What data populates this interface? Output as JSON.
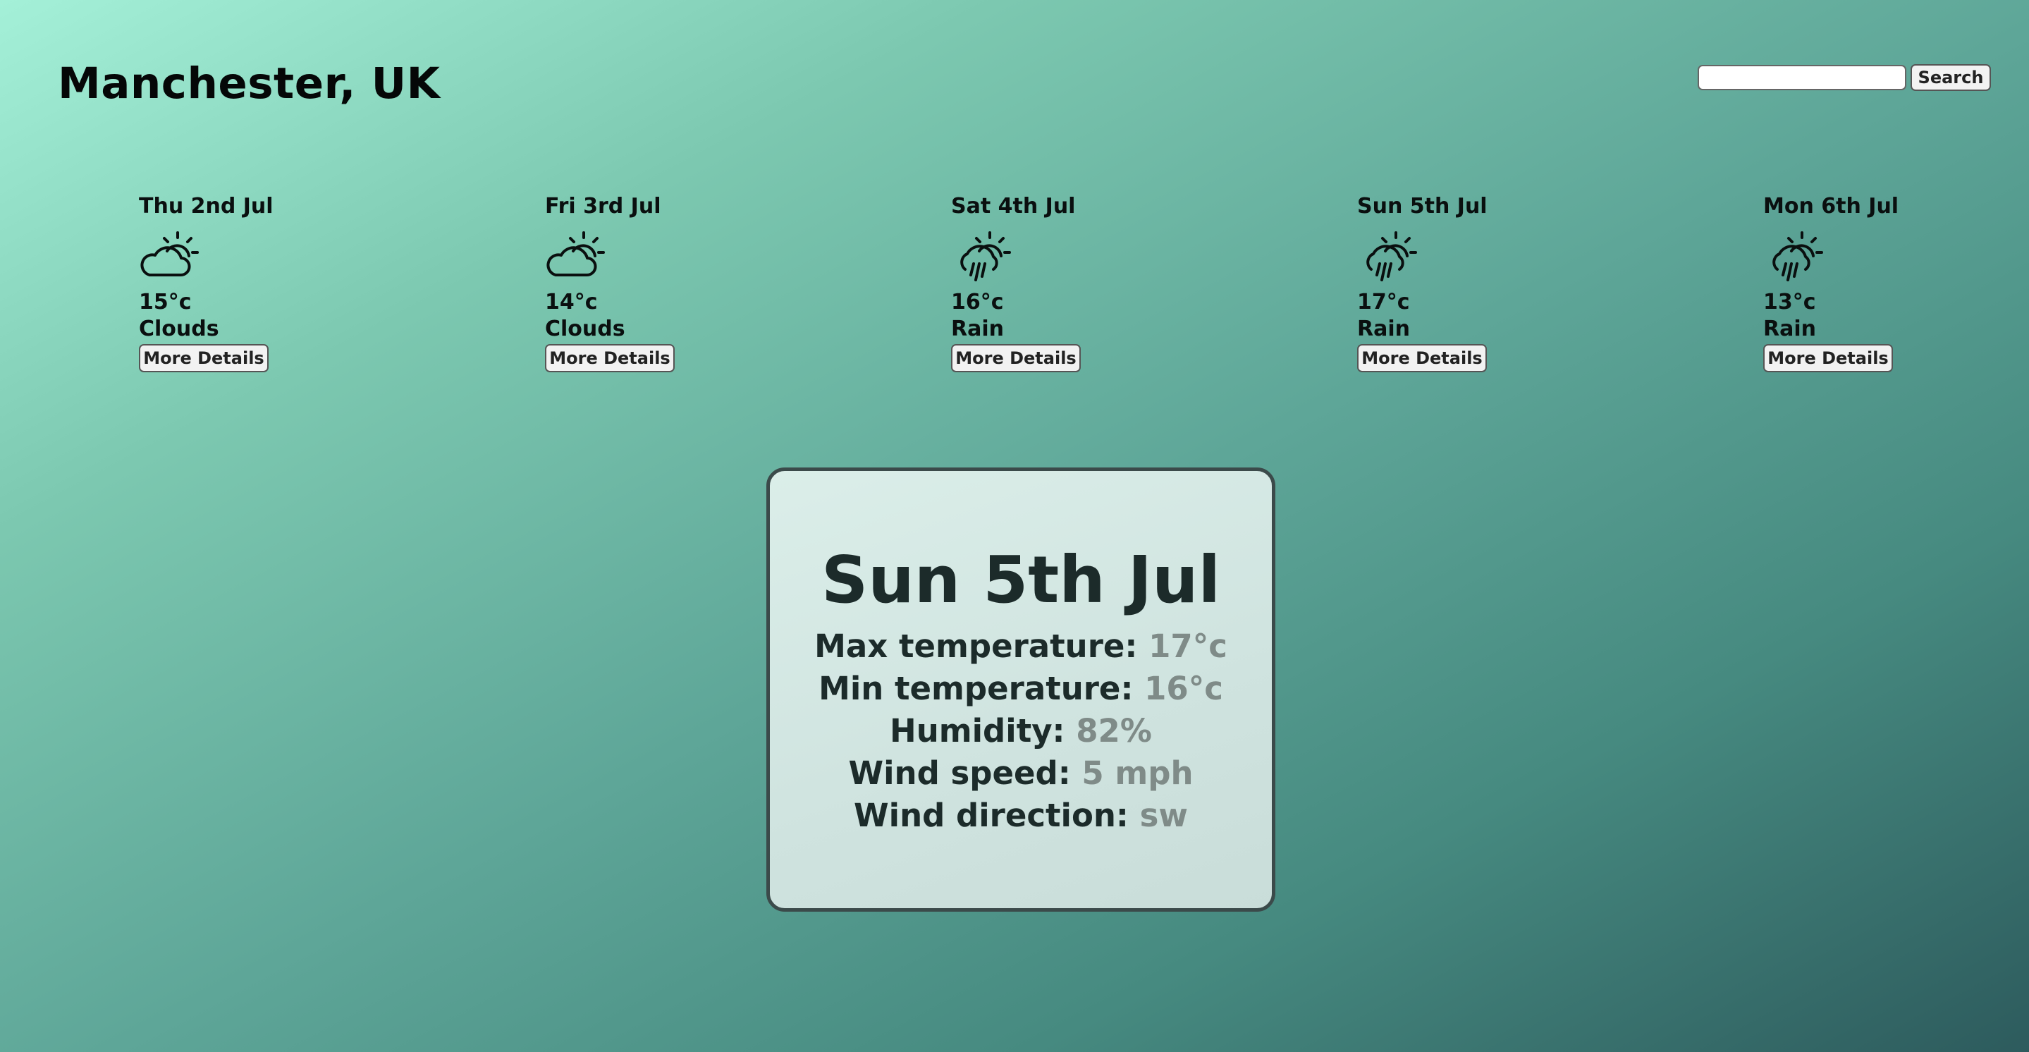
{
  "header": {
    "city": "Manchester, UK"
  },
  "search": {
    "value": "",
    "placeholder": "",
    "button_label": "Search"
  },
  "forecast": [
    {
      "date": "Thu 2nd Jul",
      "temp": "15°c",
      "description": "Clouds",
      "icon": "partly-cloudy-icon",
      "button_label": "More Details"
    },
    {
      "date": "Fri 3rd Jul",
      "temp": "14°c",
      "description": "Clouds",
      "icon": "partly-cloudy-icon",
      "button_label": "More Details"
    },
    {
      "date": "Sat 4th Jul",
      "temp": "16°c",
      "description": "Rain",
      "icon": "sun-rain-icon",
      "button_label": "More Details"
    },
    {
      "date": "Sun 5th Jul",
      "temp": "17°c",
      "description": "Rain",
      "icon": "sun-rain-icon",
      "button_label": "More Details"
    },
    {
      "date": "Mon 6th Jul",
      "temp": "13°c",
      "description": "Rain",
      "icon": "sun-rain-icon",
      "button_label": "More Details"
    }
  ],
  "details": {
    "date": "Sun 5th Jul",
    "max_temp_label": "Max temperature:",
    "max_temp": "17°c",
    "min_temp_label": "Min temperature:",
    "min_temp": "16°c",
    "humidity_label": "Humidity:",
    "humidity": "82%",
    "wind_speed_label": "Wind speed:",
    "wind_speed": "5 mph",
    "wind_direction_label": "Wind direction:",
    "wind_direction": "sw"
  },
  "colors": {
    "gradient_start": "#a4f0d8",
    "gradient_end": "#2d5b5d",
    "panel_border": "#3b4a4a",
    "detail_value": "#7f8b88"
  }
}
